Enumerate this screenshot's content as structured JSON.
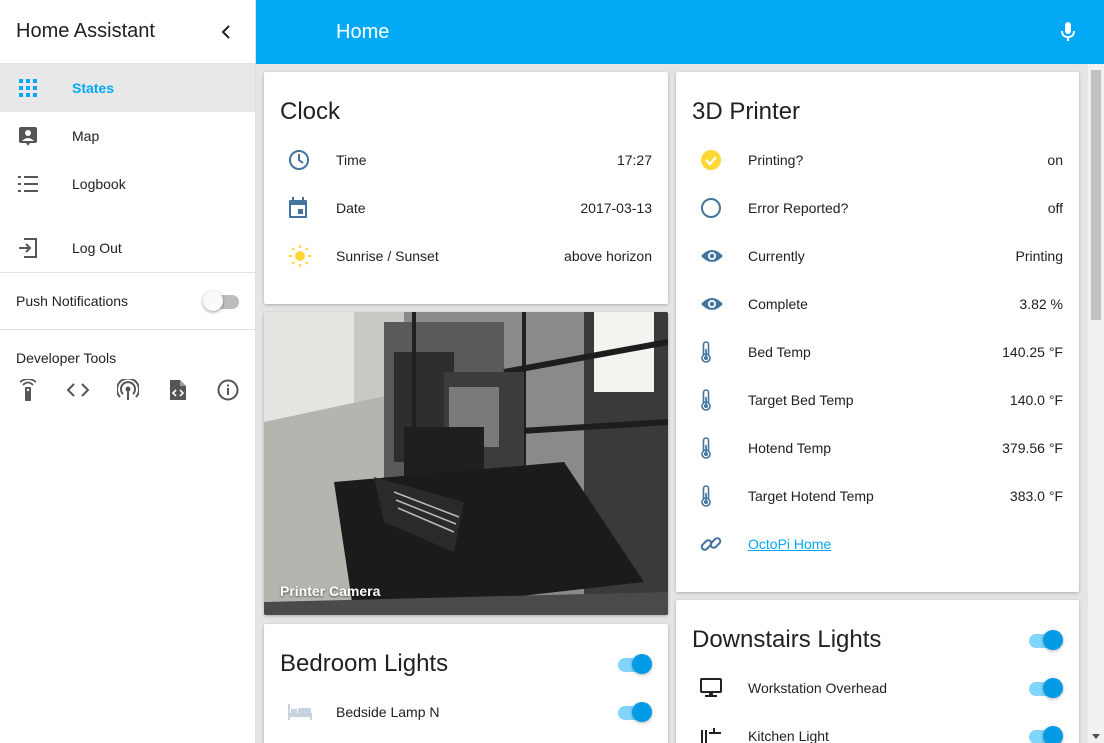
{
  "sidebar": {
    "title": "Home Assistant",
    "items": [
      {
        "label": "States",
        "icon": "grid-icon"
      },
      {
        "label": "Map",
        "icon": "account-box-icon"
      },
      {
        "label": "Logbook",
        "icon": "list-icon"
      },
      {
        "label": "Log Out",
        "icon": "exit-icon"
      }
    ],
    "push_label": "Push Notifications",
    "dev_tools_label": "Developer Tools",
    "dev_icons": [
      "remote-icon",
      "code-icon",
      "broadcast-icon",
      "file-code-icon",
      "info-icon"
    ]
  },
  "header": {
    "title": "Home"
  },
  "clock_card": {
    "title": "Clock",
    "rows": [
      {
        "name": "Time",
        "value": "17:27",
        "icon": "clock-icon"
      },
      {
        "name": "Date",
        "value": "2017-03-13",
        "icon": "calendar-icon"
      },
      {
        "name": "Sunrise / Sunset",
        "value": "above horizon",
        "icon": "sun-icon"
      }
    ]
  },
  "camera_card": {
    "caption": "Printer Camera"
  },
  "bedroom_card": {
    "title": "Bedroom Lights",
    "master_on": true,
    "rows": [
      {
        "name": "Bedside Lamp N",
        "icon": "bed-icon",
        "on": true
      }
    ]
  },
  "printer_card": {
    "title": "3D Printer",
    "rows": [
      {
        "name": "Printing?",
        "value": "on",
        "icon": "check-circle-icon"
      },
      {
        "name": "Error Reported?",
        "value": "off",
        "icon": "circle-outline-icon"
      },
      {
        "name": "Currently",
        "value": "Printing",
        "icon": "eye-icon"
      },
      {
        "name": "Complete",
        "value": "3.82 %",
        "icon": "eye-icon"
      },
      {
        "name": "Bed Temp",
        "value": "140.25 °F",
        "icon": "thermometer-icon"
      },
      {
        "name": "Target Bed Temp",
        "value": "140.0 °F",
        "icon": "thermometer-icon"
      },
      {
        "name": "Hotend Temp",
        "value": "379.56 °F",
        "icon": "thermometer-icon"
      },
      {
        "name": "Target Hotend Temp",
        "value": "383.0 °F",
        "icon": "thermometer-icon"
      }
    ],
    "link": {
      "name": "OctoPi Home",
      "icon": "link-icon"
    }
  },
  "downstairs_card": {
    "title": "Downstairs Lights",
    "master_on": true,
    "rows": [
      {
        "name": "Workstation Overhead",
        "icon": "monitor-icon",
        "on": true
      },
      {
        "name": "Kitchen Light",
        "icon": "kitchen-icon",
        "on": true
      }
    ]
  },
  "colors": {
    "accent": "#03a9f4",
    "icon_blue": "#44739e",
    "sun": "#fdd835"
  }
}
